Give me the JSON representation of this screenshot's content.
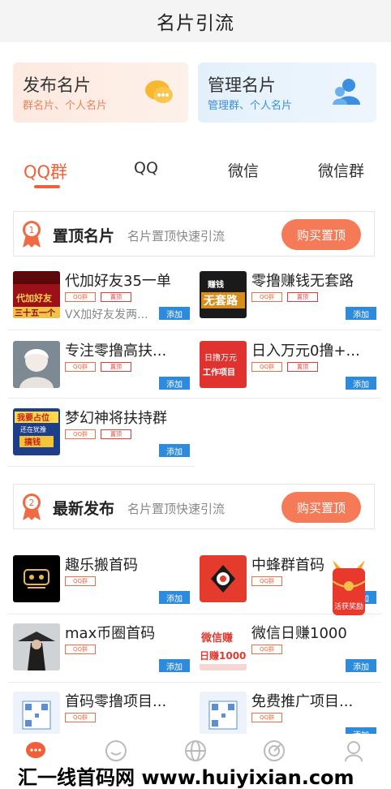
{
  "header": {
    "title": "名片引流"
  },
  "cards": {
    "publish": {
      "title": "发布名片",
      "subtitle": "群名片、个人名片",
      "icon": "chat-bubble-icon"
    },
    "manage": {
      "title": "管理名片",
      "subtitle": "管理群、个人名片",
      "icon": "user-group-icon"
    }
  },
  "tabs": [
    {
      "label": "QQ群",
      "active": true
    },
    {
      "label": "QQ",
      "active": false
    },
    {
      "label": "微信",
      "active": false
    },
    {
      "label": "微信群",
      "active": false
    }
  ],
  "pinned": {
    "title": "置顶名片",
    "subtitle": "名片置顶快速引流",
    "button": "购买置顶",
    "badge": "1",
    "items": [
      {
        "name": "代加好友35一单",
        "tags": [
          "QQ群",
          "置顶"
        ],
        "desc": "VX加好友发两...",
        "add": "添加",
        "thumb_text": "代加好友 三十五一个"
      },
      {
        "name": "零撸赚钱无套路",
        "tags": [
          "QQ群",
          "置顶"
        ],
        "desc": "",
        "add": "添加",
        "thumb_text": "赚钱 无套路"
      },
      {
        "name": "专注零撸高扶...",
        "tags": [
          "QQ群",
          "置顶"
        ],
        "desc": "",
        "add": "添加",
        "thumb_text": ""
      },
      {
        "name": "日入万元0撸+...",
        "tags": [
          "QQ群",
          "置顶"
        ],
        "desc": "",
        "add": "添加",
        "thumb_text": "日撸万元 工作项目"
      },
      {
        "name": "梦幻神将扶持群",
        "tags": [
          "QQ群",
          "置顶"
        ],
        "desc": "",
        "add": "添加",
        "thumb_text": "我要占位 还在犹豫 搞钱"
      }
    ]
  },
  "latest": {
    "title": "最新发布",
    "subtitle": "名片置顶快速引流",
    "button": "购买置顶",
    "badge": "2",
    "items": [
      {
        "name": "趣乐搬首码",
        "tags": [
          "QQ群"
        ],
        "add": "添加"
      },
      {
        "name": "中蜂群首码",
        "tags": [
          "QQ群"
        ],
        "add": "添加"
      },
      {
        "name": "max币圈首码",
        "tags": [
          "QQ群"
        ],
        "add": "添加"
      },
      {
        "name": "微信日赚1000",
        "tags": [
          "QQ群"
        ],
        "add": "添加",
        "thumb_text": "微信赚 日赚1000"
      },
      {
        "name": "首码零撸项目...",
        "tags": [
          "QQ群"
        ],
        "add": "添加"
      },
      {
        "name": "免费推广项目...",
        "tags": [
          "QQ群"
        ],
        "add": "添加"
      }
    ]
  },
  "float_gift": {
    "label": "活获奖励"
  },
  "watermark": {
    "text": "汇一线首码网 www.huiyixian.com"
  },
  "colors": {
    "accent": "#f0603a",
    "blue": "#2e8bdc"
  }
}
